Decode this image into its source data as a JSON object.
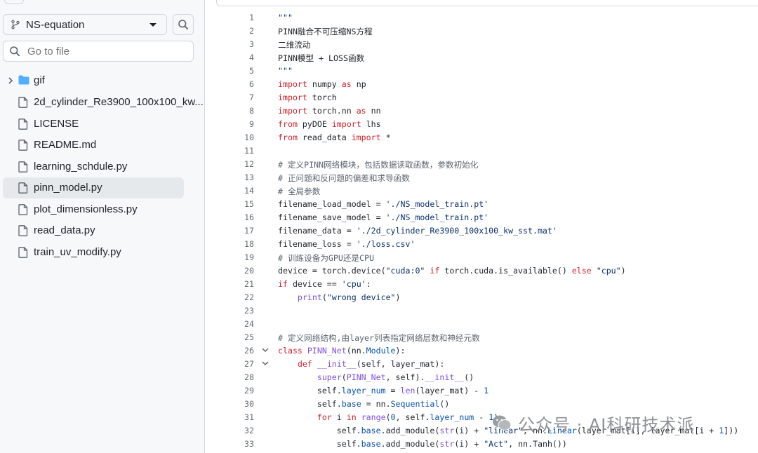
{
  "sidebar": {
    "branch": "NS-equation",
    "goto_placeholder": "Go to file",
    "items": [
      {
        "label": "gif",
        "type": "folder"
      },
      {
        "label": "2d_cylinder_Re3900_100x100_kw...",
        "type": "file"
      },
      {
        "label": "LICENSE",
        "type": "file"
      },
      {
        "label": "README.md",
        "type": "file"
      },
      {
        "label": "learning_schdule.py",
        "type": "file"
      },
      {
        "label": "pinn_model.py",
        "type": "file",
        "selected": true
      },
      {
        "label": "plot_dimensionless.py",
        "type": "file"
      },
      {
        "label": "read_data.py",
        "type": "file"
      },
      {
        "label": "train_uv_modify.py",
        "type": "file"
      }
    ]
  },
  "code": {
    "lines": [
      {
        "n": "1",
        "text": "\"\"\""
      },
      {
        "n": "2",
        "text": "PINN融合不可压缩NS方程"
      },
      {
        "n": "3",
        "text": "二维流动"
      },
      {
        "n": "4",
        "text": "PINN模型 + LOSS函数"
      },
      {
        "n": "5",
        "text": "\"\"\""
      },
      {
        "n": "6",
        "text": "import numpy as np"
      },
      {
        "n": "7",
        "text": "import torch"
      },
      {
        "n": "8",
        "text": "import torch.nn as nn"
      },
      {
        "n": "9",
        "text": "from pyDOE import lhs"
      },
      {
        "n": "10",
        "text": "from read_data import *"
      },
      {
        "n": "11",
        "text": ""
      },
      {
        "n": "12",
        "text": "# 定义PINN网络模块，包括数据读取函数，参数初始化"
      },
      {
        "n": "13",
        "text": "# 正问题和反问题的偏差和求导函数"
      },
      {
        "n": "14",
        "text": "# 全局参数"
      },
      {
        "n": "15",
        "text": "filename_load_model = './NS_model_train.pt'"
      },
      {
        "n": "16",
        "text": "filename_save_model = './NS_model_train.pt'"
      },
      {
        "n": "17",
        "text": "filename_data = './2d_cylinder_Re3900_100x100_kw_sst.mat'"
      },
      {
        "n": "18",
        "text": "filename_loss = './loss.csv'"
      },
      {
        "n": "19",
        "text": "# 训练设备为GPU还是CPU"
      },
      {
        "n": "20",
        "text": "device = torch.device(\"cuda:0\" if torch.cuda.is_available() else \"cpu\")"
      },
      {
        "n": "21",
        "text": "if device == 'cpu':"
      },
      {
        "n": "22",
        "text": "    print(\"wrong device\")"
      },
      {
        "n": "23",
        "text": ""
      },
      {
        "n": "24",
        "text": ""
      },
      {
        "n": "25",
        "text": "# 定义网络结构,由layer列表指定网络层数和神经元数"
      },
      {
        "n": "26",
        "text": "class PINN_Net(nn.Module):",
        "fold": true
      },
      {
        "n": "27",
        "text": "    def __init__(self, layer_mat):",
        "fold": true
      },
      {
        "n": "28",
        "text": "        super(PINN_Net, self).__init__()"
      },
      {
        "n": "29",
        "text": "        self.layer_num = len(layer_mat) - 1"
      },
      {
        "n": "30",
        "text": "        self.base = nn.Sequential()"
      },
      {
        "n": "31",
        "text": "        for i in range(0, self.layer_num - 1):"
      },
      {
        "n": "32",
        "text": "            self.base.add_module(str(i) + \"linear\", nn.Linear(layer_mat[i], layer_mat[i + 1]))"
      },
      {
        "n": "33",
        "text": "            self.base.add_module(str(i) + \"Act\", nn.Tanh())"
      }
    ]
  },
  "watermark": "公众号 · AI科研技术派"
}
